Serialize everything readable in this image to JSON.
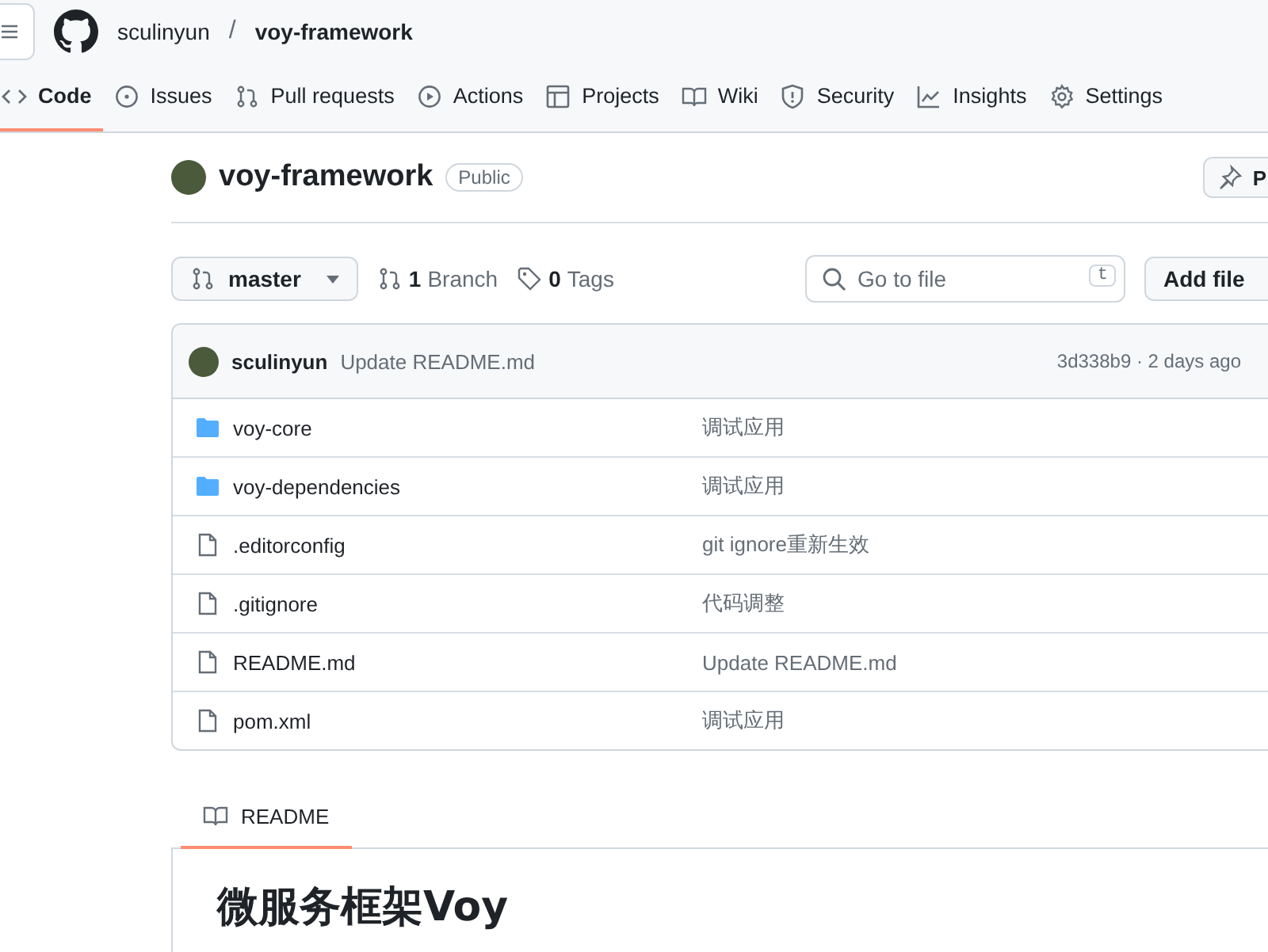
{
  "header": {
    "owner": "sculinyun",
    "separator": "/",
    "repo": "voy-framework"
  },
  "tabs": [
    {
      "label": "Code",
      "kind": "code",
      "selected": true
    },
    {
      "label": "Issues",
      "kind": "issue",
      "selected": false
    },
    {
      "label": "Pull requests",
      "kind": "pull",
      "selected": false
    },
    {
      "label": "Actions",
      "kind": "play",
      "selected": false
    },
    {
      "label": "Projects",
      "kind": "table",
      "selected": false
    },
    {
      "label": "Wiki",
      "kind": "book",
      "selected": false
    },
    {
      "label": "Security",
      "kind": "shield",
      "selected": false
    },
    {
      "label": "Insights",
      "kind": "graph",
      "selected": false
    },
    {
      "label": "Settings",
      "kind": "gear",
      "selected": false
    }
  ],
  "repo": {
    "name": "voy-framework",
    "visibility": "Public",
    "pin_button": "P"
  },
  "toolbar": {
    "branch": "master",
    "branches_count": "1",
    "branches_label": "Branch",
    "tags_count": "0",
    "tags_label": "Tags",
    "search_placeholder": "Go to file",
    "search_key": "t",
    "add_file": "Add file"
  },
  "commit": {
    "author": "sculinyun",
    "message": "Update README.md",
    "meta": "3d338b9 · 2 days ago"
  },
  "files": [
    {
      "name": "voy-core",
      "kind": "folder",
      "message": "调试应用"
    },
    {
      "name": "voy-dependencies",
      "kind": "folder",
      "message": "调试应用"
    },
    {
      "name": ".editorconfig",
      "kind": "file",
      "message": "git ignore重新生效"
    },
    {
      "name": ".gitignore",
      "kind": "file",
      "message": "代码调整"
    },
    {
      "name": "README.md",
      "kind": "file",
      "message": "Update README.md"
    },
    {
      "name": "pom.xml",
      "kind": "file",
      "message": "调试应用"
    }
  ],
  "readme": {
    "tab": "README",
    "heading": "微服务框架Voy"
  }
}
